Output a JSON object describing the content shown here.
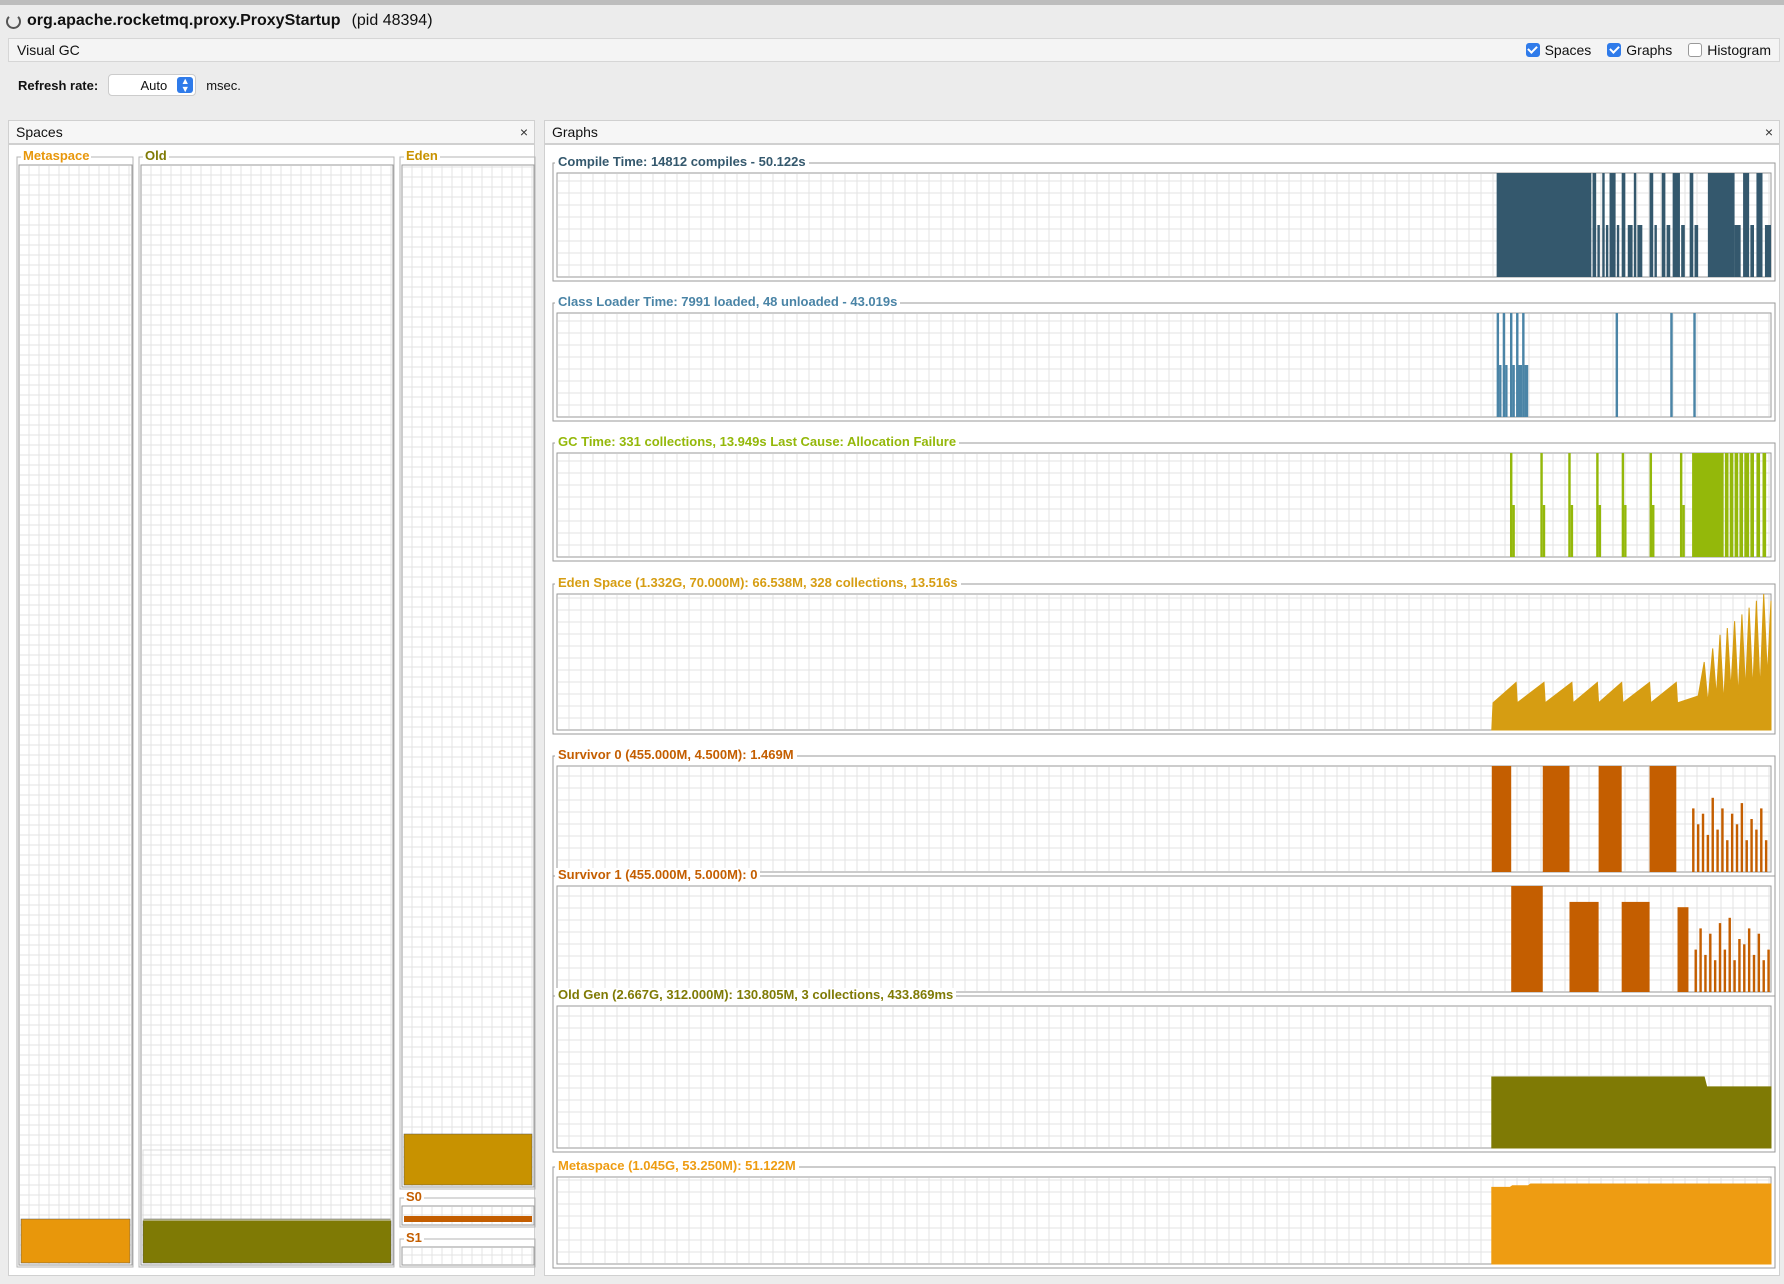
{
  "window": {
    "title": "org.apache.rocketmq.proxy.ProxyStartup",
    "pid": "(pid 48394)"
  },
  "plugin": {
    "name": "Visual GC",
    "checkboxes": [
      {
        "label": "Spaces",
        "checked": true
      },
      {
        "label": "Graphs",
        "checked": true
      },
      {
        "label": "Histogram",
        "checked": false
      }
    ]
  },
  "refresh": {
    "label": "Refresh rate:",
    "value": "Auto",
    "unit": "msec."
  },
  "spaces_panel": {
    "title": "Spaces",
    "close": "×",
    "spaces": [
      {
        "key": "metaspace",
        "label": "Metaspace",
        "color": "#e8970b",
        "used_fraction": 0.04
      },
      {
        "key": "old",
        "label": "Old",
        "color": "#7f7a05",
        "used_fraction": 0.04
      },
      {
        "key": "eden",
        "label": "Eden",
        "color": "#c89200",
        "used_fraction": 0.05
      },
      {
        "key": "s0",
        "label": "S0",
        "color": "#c45e00",
        "used_fraction": 0.33
      },
      {
        "key": "s1",
        "label": "S1",
        "color": "#c45e00",
        "used_fraction": 0.0
      }
    ]
  },
  "graphs_panel": {
    "title": "Graphs",
    "close": "×"
  },
  "chart_data": [
    {
      "type": "bar",
      "key": "compile",
      "title": "Compile Time: 14812 compiles - 50.122s",
      "color": "#34586d",
      "range": [
        0,
        1
      ],
      "bars": [
        [
          0.774,
          0.852,
          1.0
        ],
        [
          0.853,
          0.856,
          1.0
        ],
        [
          0.857,
          0.859,
          0.5
        ],
        [
          0.861,
          0.863,
          1.0
        ],
        [
          0.864,
          0.866,
          0.5
        ],
        [
          0.867,
          0.872,
          1.0
        ],
        [
          0.873,
          0.875,
          0.5
        ],
        [
          0.877,
          0.88,
          1.0
        ],
        [
          0.882,
          0.886,
          0.5
        ],
        [
          0.887,
          0.889,
          1.0
        ],
        [
          0.89,
          0.894,
          0.5
        ],
        [
          0.9,
          0.903,
          1.0
        ],
        [
          0.904,
          0.906,
          0.5
        ],
        [
          0.91,
          0.913,
          1.0
        ],
        [
          0.914,
          0.917,
          0.5
        ],
        [
          0.919,
          0.925,
          1.0
        ],
        [
          0.926,
          0.929,
          0.5
        ],
        [
          0.933,
          0.936,
          1.0
        ],
        [
          0.937,
          0.94,
          0.5
        ],
        [
          0.948,
          0.97,
          1.0
        ],
        [
          0.97,
          0.975,
          0.5
        ],
        [
          0.977,
          0.982,
          1.0
        ],
        [
          0.983,
          0.986,
          0.5
        ],
        [
          0.988,
          0.993,
          1.0
        ],
        [
          0.995,
          1.0,
          0.5
        ]
      ]
    },
    {
      "type": "bar",
      "key": "classloader",
      "title": "Class Loader Time: 7991 loaded, 48 unloaded - 43.019s",
      "color": "#4a84a6",
      "range": [
        0,
        1
      ],
      "bars": [
        [
          0.774,
          0.776,
          1.0
        ],
        [
          0.776,
          0.778,
          0.5
        ],
        [
          0.779,
          0.781,
          1.0
        ],
        [
          0.781,
          0.783,
          0.5
        ],
        [
          0.785,
          0.787,
          1.0
        ],
        [
          0.787,
          0.789,
          0.5
        ],
        [
          0.79,
          0.792,
          1.0
        ],
        [
          0.792,
          0.795,
          0.5
        ],
        [
          0.795,
          0.797,
          1.0
        ],
        [
          0.797,
          0.8,
          0.5
        ],
        [
          0.872,
          0.874,
          1.0
        ],
        [
          0.917,
          0.919,
          1.0
        ],
        [
          0.936,
          0.938,
          1.0
        ]
      ]
    },
    {
      "type": "bar",
      "key": "gc",
      "title": "GC Time: 331 collections, 13.949s  Last Cause: Allocation Failure",
      "color": "#94b80a",
      "range": [
        0,
        1
      ],
      "bars": [
        [
          0.785,
          0.787,
          1.0
        ],
        [
          0.787,
          0.789,
          0.5
        ],
        [
          0.81,
          0.812,
          1.0
        ],
        [
          0.812,
          0.814,
          0.5
        ],
        [
          0.833,
          0.835,
          1.0
        ],
        [
          0.835,
          0.837,
          0.5
        ],
        [
          0.856,
          0.858,
          1.0
        ],
        [
          0.858,
          0.86,
          0.5
        ],
        [
          0.877,
          0.879,
          1.0
        ],
        [
          0.879,
          0.881,
          0.5
        ],
        [
          0.9,
          0.902,
          1.0
        ],
        [
          0.902,
          0.904,
          0.5
        ],
        [
          0.925,
          0.927,
          1.0
        ],
        [
          0.927,
          0.929,
          0.5
        ],
        [
          0.935,
          0.958,
          1.0
        ],
        [
          0.958,
          0.961,
          1.0
        ],
        [
          0.962,
          0.965,
          1.0
        ],
        [
          0.966,
          0.969,
          1.0
        ],
        [
          0.97,
          0.973,
          1.0
        ],
        [
          0.974,
          0.977,
          1.0
        ],
        [
          0.978,
          0.982,
          1.0
        ],
        [
          0.983,
          0.986,
          1.0
        ],
        [
          0.988,
          0.991,
          1.0
        ],
        [
          0.993,
          0.996,
          1.0
        ]
      ]
    },
    {
      "type": "area",
      "key": "eden",
      "title": "Eden Space (1.332G, 70.000M): 66.538M, 328 collections, 13.516s",
      "color": "#d69d12",
      "range": [
        0,
        1
      ],
      "points": [
        [
          0.77,
          0.0
        ],
        [
          0.771,
          0.2
        ],
        [
          0.79,
          0.35
        ],
        [
          0.791,
          0.2
        ],
        [
          0.813,
          0.35
        ],
        [
          0.814,
          0.2
        ],
        [
          0.836,
          0.35
        ],
        [
          0.837,
          0.2
        ],
        [
          0.857,
          0.35
        ],
        [
          0.858,
          0.2
        ],
        [
          0.877,
          0.35
        ],
        [
          0.878,
          0.2
        ],
        [
          0.9,
          0.35
        ],
        [
          0.901,
          0.2
        ],
        [
          0.922,
          0.35
        ],
        [
          0.923,
          0.2
        ],
        [
          0.94,
          0.25
        ],
        [
          0.945,
          0.5
        ],
        [
          0.948,
          0.2
        ],
        [
          0.952,
          0.6
        ],
        [
          0.955,
          0.25
        ],
        [
          0.958,
          0.7
        ],
        [
          0.961,
          0.2
        ],
        [
          0.964,
          0.75
        ],
        [
          0.967,
          0.3
        ],
        [
          0.97,
          0.8
        ],
        [
          0.973,
          0.25
        ],
        [
          0.976,
          0.85
        ],
        [
          0.979,
          0.3
        ],
        [
          0.982,
          0.9
        ],
        [
          0.985,
          0.3
        ],
        [
          0.988,
          0.95
        ],
        [
          0.991,
          0.3
        ],
        [
          0.994,
          1.0
        ],
        [
          0.997,
          0.4
        ],
        [
          1.0,
          0.95
        ],
        [
          1.0,
          0.0
        ]
      ]
    },
    {
      "type": "bar",
      "key": "s0",
      "title": "Survivor 0 (455.000M, 4.500M): 1.469M",
      "color": "#c45e00",
      "range": [
        0,
        1
      ],
      "bars": [
        [
          0.77,
          0.786,
          1.0
        ],
        [
          0.812,
          0.834,
          1.0
        ],
        [
          0.858,
          0.877,
          1.0
        ],
        [
          0.9,
          0.922,
          1.0
        ],
        [
          0.935,
          0.937,
          0.6
        ],
        [
          0.939,
          0.941,
          0.45
        ],
        [
          0.943,
          0.945,
          0.55
        ],
        [
          0.947,
          0.949,
          0.35
        ],
        [
          0.951,
          0.953,
          0.7
        ],
        [
          0.955,
          0.957,
          0.4
        ],
        [
          0.959,
          0.961,
          0.6
        ],
        [
          0.963,
          0.965,
          0.3
        ],
        [
          0.967,
          0.969,
          0.55
        ],
        [
          0.971,
          0.973,
          0.45
        ],
        [
          0.975,
          0.977,
          0.65
        ],
        [
          0.979,
          0.981,
          0.3
        ],
        [
          0.983,
          0.985,
          0.5
        ],
        [
          0.987,
          0.989,
          0.4
        ],
        [
          0.991,
          0.993,
          0.6
        ],
        [
          0.995,
          0.997,
          0.3
        ]
      ]
    },
    {
      "type": "bar",
      "key": "s1",
      "title": "Survivor 1 (455.000M, 5.000M): 0",
      "color": "#c45e00",
      "range": [
        0,
        1
      ],
      "bars": [
        [
          0.786,
          0.812,
          1.0
        ],
        [
          0.834,
          0.858,
          0.85
        ],
        [
          0.877,
          0.9,
          0.85
        ],
        [
          0.923,
          0.932,
          0.8
        ],
        [
          0.937,
          0.939,
          0.4
        ],
        [
          0.941,
          0.943,
          0.6
        ],
        [
          0.945,
          0.947,
          0.35
        ],
        [
          0.949,
          0.951,
          0.55
        ],
        [
          0.953,
          0.955,
          0.3
        ],
        [
          0.957,
          0.959,
          0.65
        ],
        [
          0.961,
          0.963,
          0.4
        ],
        [
          0.965,
          0.967,
          0.7
        ],
        [
          0.969,
          0.971,
          0.3
        ],
        [
          0.973,
          0.975,
          0.5
        ],
        [
          0.977,
          0.979,
          0.45
        ],
        [
          0.981,
          0.983,
          0.6
        ],
        [
          0.985,
          0.987,
          0.35
        ],
        [
          0.989,
          0.991,
          0.55
        ],
        [
          0.993,
          0.995,
          0.3
        ],
        [
          0.997,
          0.999,
          0.4
        ]
      ]
    },
    {
      "type": "area",
      "key": "old",
      "title": "Old Gen (2.667G, 312.000M): 130.805M, 3 collections, 433.869ms",
      "color": "#7f7a05",
      "range": [
        0,
        1
      ],
      "points": [
        [
          0.77,
          0.0
        ],
        [
          0.77,
          0.5
        ],
        [
          0.945,
          0.5
        ],
        [
          0.947,
          0.43
        ],
        [
          1.0,
          0.43
        ],
        [
          1.0,
          0.0
        ]
      ]
    },
    {
      "type": "area",
      "key": "meta",
      "title": "Metaspace (1.045G, 53.250M): 51.122M",
      "color": "#ee9c12",
      "range": [
        0,
        1
      ],
      "points": [
        [
          0.77,
          0.0
        ],
        [
          0.77,
          0.88
        ],
        [
          0.785,
          0.88
        ],
        [
          0.787,
          0.9
        ],
        [
          0.8,
          0.9
        ],
        [
          0.802,
          0.92
        ],
        [
          1.0,
          0.92
        ],
        [
          1.0,
          0.0
        ]
      ]
    }
  ]
}
